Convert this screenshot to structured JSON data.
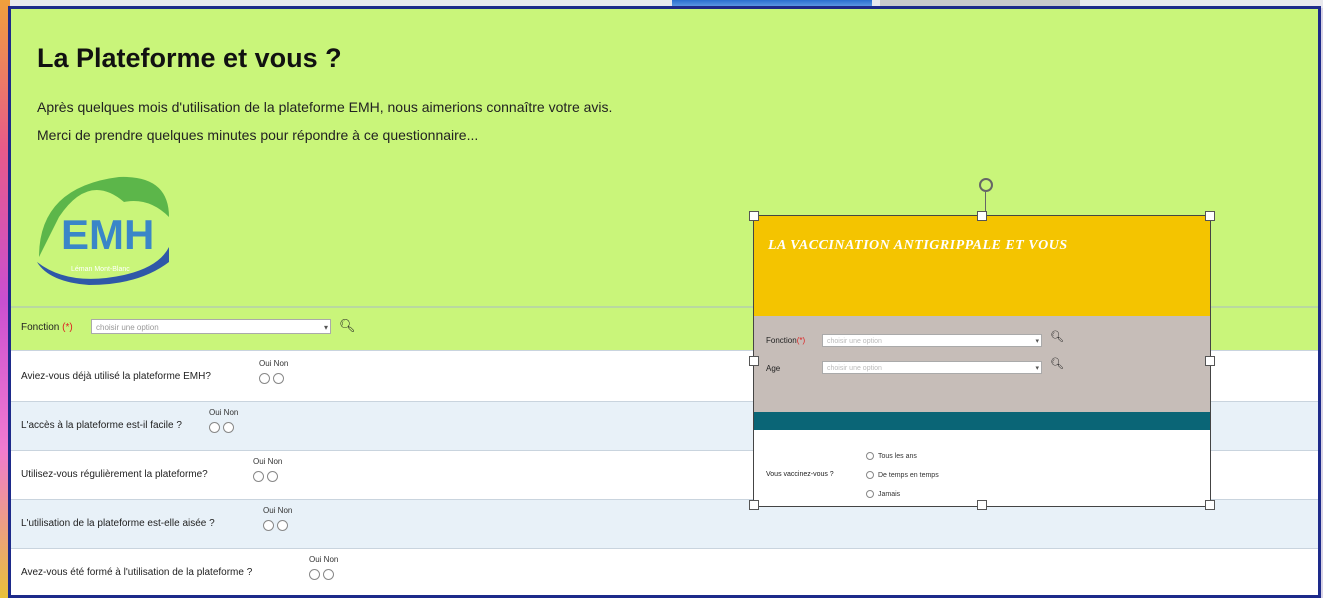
{
  "header": {
    "title": "La Plateforme et vous ?",
    "intro_line1": "Après quelques mois d'utilisation de la plateforme EMH, nous aimerions connaître votre avis.",
    "intro_line2": "Merci de prendre quelques minutes pour répondre à ce questionnaire...",
    "logo_text": "EMH",
    "logo_subtext": "Léman Mont-Blanc"
  },
  "fonction": {
    "label": "Fonction",
    "required_mark": "(*)",
    "placeholder": "choisir une option"
  },
  "questions": [
    {
      "text": "Aviez-vous déjà utilisé la plateforme EMH?",
      "options": "Oui Non"
    },
    {
      "text": "L'accès à la plateforme est-il facile ?",
      "options": "Oui Non"
    },
    {
      "text": "Utilisez-vous régulièrement la plateforme?",
      "options": "Oui Non"
    },
    {
      "text": "L'utilisation de la plateforme est-elle aisée ?",
      "options": "Oui Non"
    },
    {
      "text": "Avez-vous été formé à l'utilisation de la plateforme ?",
      "options": "Oui Non"
    }
  ],
  "card": {
    "title": "LA VACCINATION ANTIGRIPPALE ET VOUS",
    "fonction_label": "Fonction",
    "required_mark": "(*)",
    "age_label": "Age",
    "select_placeholder": "choisir une option",
    "vaccin_question": "Vous vaccinez-vous ?",
    "vaccin_options": [
      "Tous les ans",
      "De temps en temps",
      "Jamais"
    ]
  },
  "colors": {
    "header_bg": "#c9f57a",
    "card_header": "#f4c400",
    "card_teal": "#0a6576",
    "frame_border": "#1d2a8a"
  }
}
